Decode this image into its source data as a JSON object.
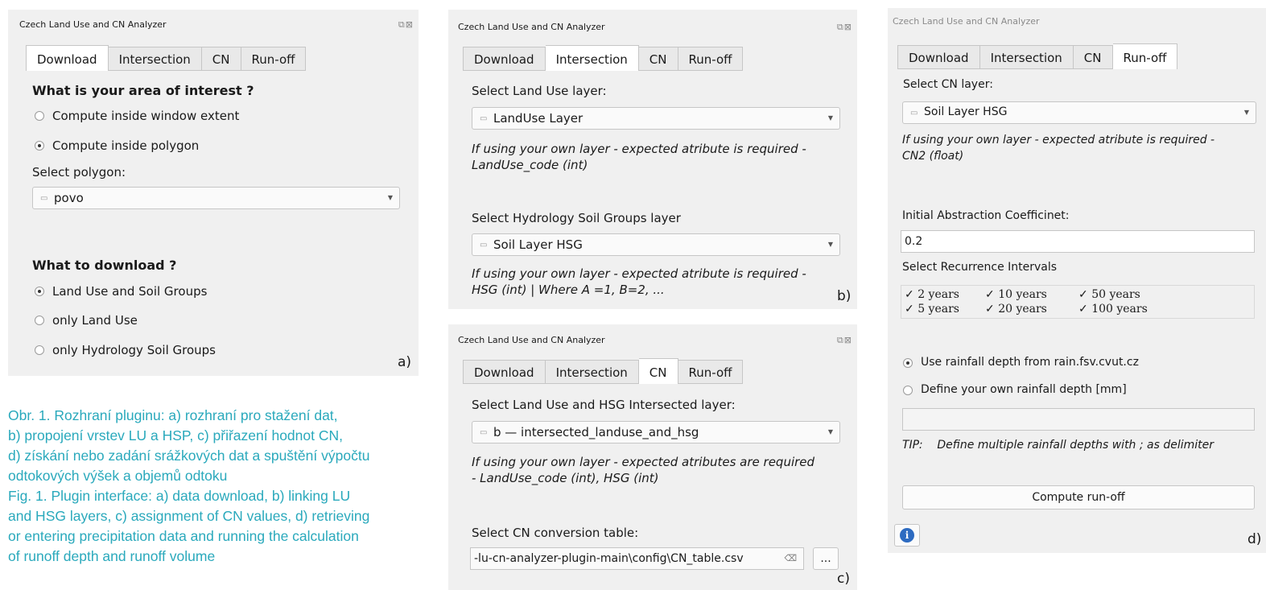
{
  "dialog_title": "Czech Land Use and CN Analyzer",
  "tabs": [
    "Download",
    "Intersection",
    "CN",
    "Run-off"
  ],
  "panel_a": {
    "area_heading": "What is your area of interest ?",
    "area_options": [
      "Compute inside window extent",
      "Compute inside polygon"
    ],
    "select_polygon_label": "Select polygon:",
    "polygon_value": "povo",
    "download_heading": "What to download ?",
    "download_options": [
      "Land Use and Soil Groups",
      "only Land Use",
      "only Hydrology Soil Groups"
    ],
    "letter": "a)"
  },
  "panel_b": {
    "landuse_label": "Select Land Use layer:",
    "landuse_value": "LandUse Layer",
    "landuse_hint": [
      "If using your own layer - expected atribute is required -",
      "LandUse_code (int)"
    ],
    "hsg_label": "Select Hydrology Soil Groups layer",
    "hsg_value": "Soil Layer HSG",
    "hsg_hint": [
      "If using your own layer - expected atribute is required -",
      "HSG (int)  | Where A =1, B=2, ..."
    ],
    "letter": "b)"
  },
  "panel_c": {
    "intersected_label": "Select Land Use and HSG Intersected layer:",
    "intersected_value": "b — intersected_landuse_and_hsg",
    "intersected_hint": [
      "If using your own layer - expected atributes are required",
      "- LandUse_code (int), HSG (int)"
    ],
    "table_label": "Select CN conversion table:",
    "table_path": "-lu-cn-analyzer-plugin-main\\config\\CN_table.csv",
    "browse_label": "...",
    "letter": "c)"
  },
  "panel_d": {
    "cn_label": "Select CN layer:",
    "cn_value": "Soil Layer HSG",
    "cn_hint": [
      "If using your own layer - expected atribute is required -",
      "CN2 (float)"
    ],
    "abstraction_label": "Initial Abstraction Coefficinet:",
    "abstraction_value": "0.2",
    "recurrence_label": "Select Recurrence Intervals",
    "recurrence": [
      "2 years",
      "10 years",
      "50 years",
      "5 years",
      "20 years",
      "100 years"
    ],
    "rain_options": [
      "Use rainfall depth from rain.fsv.cvut.cz",
      "Define your own rainfall depth [mm]"
    ],
    "tip_label": "TIP:",
    "tip_text": "Define multiple rainfall depths with  ;  as delimiter",
    "compute_label": "Compute run-off",
    "letter": "d)"
  },
  "caption_lines": [
    "Obr. 1. Rozhraní pluginu: a) rozhraní pro stažení dat,",
    "b) propojení vrstev LU a HSP, c) přiřazení hodnot CN,",
    "d) získání nebo zadání srážkových dat a spuštění výpočtu",
    "odtokových výšek a objemů odtoku",
    "Fig. 1. Plugin interface: a) data download, b) linking LU",
    "and HSG layers, c) assignment of CN values, d) retrieving",
    "or entering precipitation data and running the calculation",
    "of runoff depth and runoff volume"
  ]
}
